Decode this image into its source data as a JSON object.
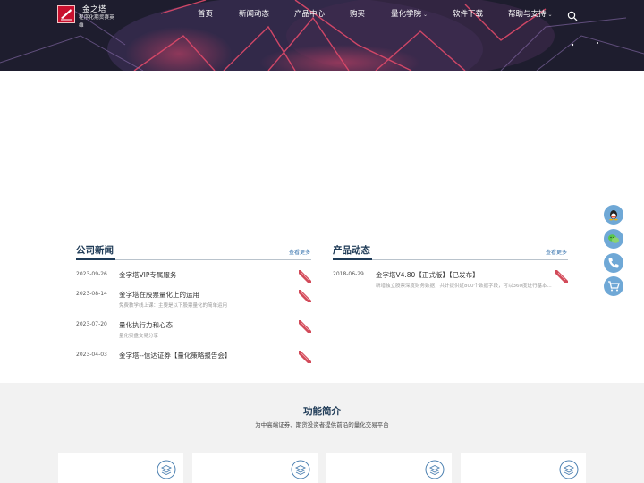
{
  "header": {
    "logo": {
      "name": "金之塔",
      "tagline": "程序化期货赛英雄"
    },
    "nav": [
      {
        "label": "首页",
        "dropdown": false
      },
      {
        "label": "新闻动态",
        "dropdown": false
      },
      {
        "label": "产品中心",
        "dropdown": false
      },
      {
        "label": "购买",
        "dropdown": false
      },
      {
        "label": "量化学院",
        "dropdown": true
      },
      {
        "label": "软件下载",
        "dropdown": false
      },
      {
        "label": "帮助与支持",
        "dropdown": true
      }
    ],
    "search_icon": "search-icon"
  },
  "company_news": {
    "title": "公司新闻",
    "more_label": "查看更多",
    "items": [
      {
        "date": "2023-09-26",
        "title": "金字塔VIP专属服务",
        "desc": ""
      },
      {
        "date": "2023-08-14",
        "title": "金字塔在股票量化上的运用",
        "desc": "免费教学线上课：主要是以下股票量化的简单运用"
      },
      {
        "date": "2023-07-20",
        "title": "量化执行力和心态",
        "desc": "量化实盘交易分享"
      },
      {
        "date": "2023-04-03",
        "title": "金字塔--信达证券【量化策略报告会】",
        "desc": ""
      }
    ]
  },
  "product_news": {
    "title": "产品动态",
    "more_label": "查看更多",
    "items": [
      {
        "date": "2018-06-29",
        "title": "金字塔V4.80【正式版】【已发布】",
        "desc": "新增独立股票深度财务数据，共计提供近800个数据字段，可以360度进行基本..."
      }
    ]
  },
  "features": {
    "title": "功能简介",
    "subtitle": "为中高端证券、期货投资者提供前沿的量化交易平台",
    "cards": [
      {
        "icon": "stack-icon"
      },
      {
        "icon": "stack-icon"
      },
      {
        "icon": "stack-icon"
      },
      {
        "icon": "stack-icon"
      }
    ]
  },
  "floating": [
    {
      "icon": "qq-icon"
    },
    {
      "icon": "wechat-icon"
    },
    {
      "icon": "phone-icon"
    },
    {
      "icon": "cart-icon"
    }
  ],
  "colors": {
    "brand_red": "#c8102e",
    "heading_navy": "#1f3b57",
    "float_blue": "#6fa8d6",
    "feature_bg": "#f2f2f2"
  }
}
